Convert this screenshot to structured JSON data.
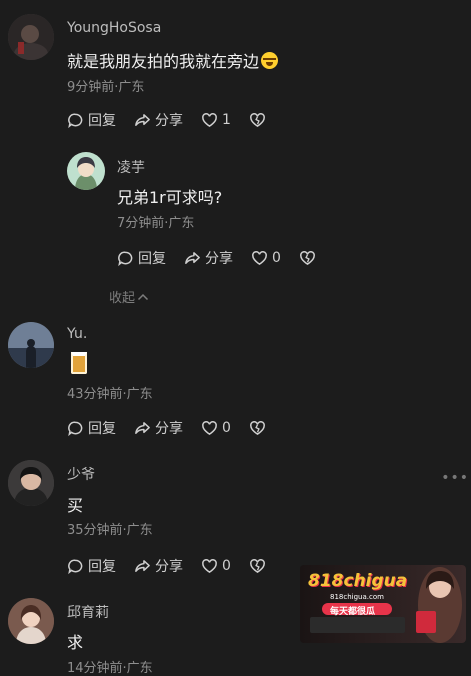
{
  "comments": [
    {
      "user": "YoungHoSosa",
      "text": "就是我朋友拍的我就在旁边",
      "meta": "9分钟前·广东",
      "actions": {
        "reply": "回复",
        "share": "分享",
        "likes": "1"
      }
    },
    {
      "user": "凌芋",
      "text": "兄弟1r可求吗?",
      "meta": "7分钟前·广东",
      "actions": {
        "reply": "回复",
        "share": "分享",
        "likes": "0"
      }
    },
    {
      "user": "Yu.",
      "meta": "43分钟前·广东",
      "actions": {
        "reply": "回复",
        "share": "分享",
        "likes": "0"
      }
    },
    {
      "user": "少爷",
      "text": "买",
      "meta": "35分钟前·广东",
      "actions": {
        "reply": "回复",
        "share": "分享",
        "likes": "0"
      }
    },
    {
      "user": "邱育莉",
      "text": "求",
      "meta": "14分钟前·广东"
    }
  ],
  "collapse_label": "收起",
  "ad": {
    "brand": "818chigua",
    "site": "818chigua.com",
    "slogan": "每天都很瓜",
    "colors": {
      "brand_red": "#e8344a",
      "brand_gold": "#f5c23a"
    }
  },
  "colors": {
    "background": "#1c1c1c",
    "meta": "#8e8e8e",
    "text": "#efefef"
  }
}
